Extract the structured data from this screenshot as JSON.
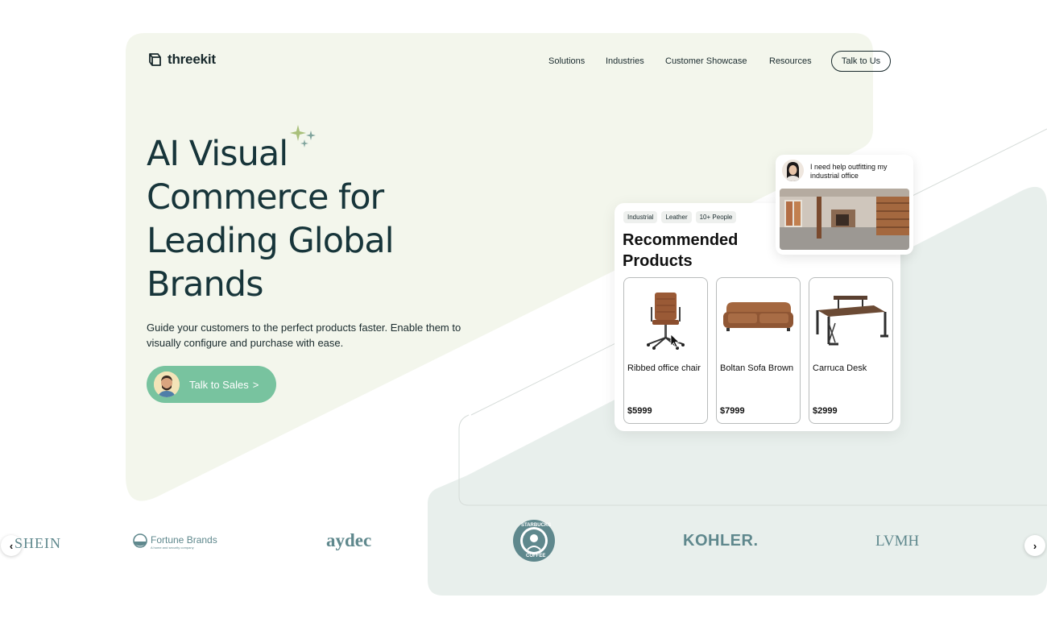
{
  "nav": {
    "logo_text": "threekit",
    "items": [
      "Solutions",
      "Industries",
      "Customer Showcase",
      "Resources"
    ],
    "cta_label": "Talk to Us"
  },
  "hero": {
    "title_lines": [
      "AI Visual",
      "Commerce for",
      "Leading Global",
      "Brands"
    ],
    "subtitle": "Guide your customers to the perfect products faster. Enable them to visually configure and purchase with ease.",
    "sales_button_label": "Talk to Sales",
    "sales_button_chevron": ">"
  },
  "recommendation": {
    "tags": [
      "Industrial",
      "Leather",
      "10+ People"
    ],
    "title": "Recommended Products",
    "products": [
      {
        "name": "Ribbed office chair",
        "price": "$5999",
        "icon": "office-chair-icon"
      },
      {
        "name": "Boltan Sofa Brown",
        "price": "$7999",
        "icon": "sofa-icon"
      },
      {
        "name": "Carruca Desk",
        "price": "$2999",
        "icon": "desk-icon"
      }
    ]
  },
  "chat": {
    "message": "I need help outfitting my industrial office"
  },
  "brands": {
    "items": [
      "SHEIN",
      "Fortune Brands",
      "A home and security company",
      "aydec",
      "STARBUCKS",
      "COFFEE",
      "KOHLER.",
      "LVMH"
    ],
    "prev_icon": "chevron-left-icon",
    "next_icon": "chevron-right-icon",
    "prev_glyph": "‹",
    "next_glyph": "›"
  },
  "colors": {
    "hero_bg": "#f3f6ec",
    "accent_green": "#78c39f",
    "brand_teal": "#5f888d",
    "shape_gray": "#e9efec",
    "title_dark": "#17353a"
  }
}
